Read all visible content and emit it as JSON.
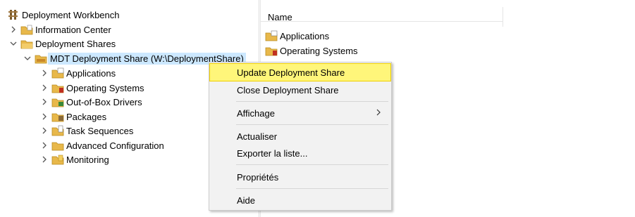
{
  "tree": {
    "root": {
      "label": "Deployment Workbench",
      "icon": "workbench-icon"
    },
    "info_center": {
      "label": "Information Center",
      "icon": "folder-info-icon"
    },
    "deployment_shares": {
      "label": "Deployment Shares",
      "icon": "folder-shares-icon"
    },
    "share": {
      "label": "MDT Deployment Share (W:\\DeploymentShare)",
      "icon": "share-folder-icon"
    },
    "children": [
      {
        "label": "Applications",
        "icon": "applications-folder-icon"
      },
      {
        "label": "Operating Systems",
        "icon": "operating-systems-folder-icon"
      },
      {
        "label": "Out-of-Box Drivers",
        "icon": "drivers-folder-icon"
      },
      {
        "label": "Packages",
        "icon": "packages-folder-icon"
      },
      {
        "label": "Task Sequences",
        "icon": "task-sequences-folder-icon"
      },
      {
        "label": "Advanced Configuration",
        "icon": "advanced-config-folder-icon"
      },
      {
        "label": "Monitoring",
        "icon": "monitoring-folder-icon"
      }
    ]
  },
  "list": {
    "column_name": "Name",
    "items": [
      {
        "label": "Applications",
        "icon": "applications-folder-icon"
      },
      {
        "label": "Operating Systems",
        "icon": "operating-systems-folder-icon"
      }
    ]
  },
  "context_menu": {
    "items": [
      {
        "label": "Update Deployment Share",
        "highlighted": true
      },
      {
        "label": "Close Deployment Share"
      },
      {
        "label": "Affichage",
        "submenu": true
      },
      {
        "label": "Actualiser"
      },
      {
        "label": "Exporter la liste..."
      },
      {
        "label": "Propriétés"
      },
      {
        "label": "Aide"
      }
    ],
    "highlight_color": "#fff67a",
    "highlight_border": "#f0d000"
  },
  "colors": {
    "selection": "#cce8ff",
    "folder": "#e8b84a"
  }
}
